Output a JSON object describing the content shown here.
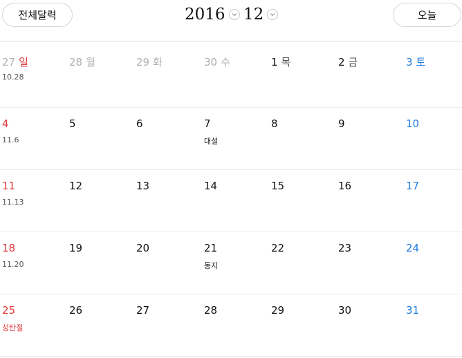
{
  "header": {
    "all_calendar_label": "전체달력",
    "year": "2016",
    "month": "12",
    "today_label": "오늘"
  },
  "colors": {
    "sunday": "#e03a3a",
    "saturday": "#1f7ae0",
    "other_month": "#b0b0b0"
  },
  "weeks": [
    [
      {
        "num": "27",
        "name": "일",
        "sub": "10.28",
        "num_style": "other",
        "name_style": "sun",
        "sub_style": "gray"
      },
      {
        "num": "28",
        "name": "월",
        "sub": "",
        "num_style": "other",
        "name_style": "other",
        "sub_style": ""
      },
      {
        "num": "29",
        "name": "화",
        "sub": "",
        "num_style": "other",
        "name_style": "other",
        "sub_style": ""
      },
      {
        "num": "30",
        "name": "수",
        "sub": "",
        "num_style": "other",
        "name_style": "other",
        "sub_style": ""
      },
      {
        "num": "1",
        "name": "목",
        "sub": "",
        "num_style": "norm",
        "name_style": "gray",
        "sub_style": ""
      },
      {
        "num": "2",
        "name": "금",
        "sub": "",
        "num_style": "norm",
        "name_style": "gray",
        "sub_style": ""
      },
      {
        "num": "3",
        "name": "토",
        "sub": "",
        "num_style": "sat",
        "name_style": "sat",
        "sub_style": ""
      }
    ],
    [
      {
        "num": "4",
        "name": "",
        "sub": "11.6",
        "num_style": "sun",
        "name_style": "",
        "sub_style": "gray"
      },
      {
        "num": "5",
        "name": "",
        "sub": "",
        "num_style": "norm",
        "name_style": "",
        "sub_style": ""
      },
      {
        "num": "6",
        "name": "",
        "sub": "",
        "num_style": "norm",
        "name_style": "",
        "sub_style": ""
      },
      {
        "num": "7",
        "name": "",
        "sub": "대설",
        "num_style": "norm",
        "name_style": "",
        "sub_style": "dark"
      },
      {
        "num": "8",
        "name": "",
        "sub": "",
        "num_style": "norm",
        "name_style": "",
        "sub_style": ""
      },
      {
        "num": "9",
        "name": "",
        "sub": "",
        "num_style": "norm",
        "name_style": "",
        "sub_style": ""
      },
      {
        "num": "10",
        "name": "",
        "sub": "",
        "num_style": "sat",
        "name_style": "",
        "sub_style": ""
      }
    ],
    [
      {
        "num": "11",
        "name": "",
        "sub": "11.13",
        "num_style": "sun",
        "name_style": "",
        "sub_style": "gray"
      },
      {
        "num": "12",
        "name": "",
        "sub": "",
        "num_style": "norm",
        "name_style": "",
        "sub_style": ""
      },
      {
        "num": "13",
        "name": "",
        "sub": "",
        "num_style": "norm",
        "name_style": "",
        "sub_style": ""
      },
      {
        "num": "14",
        "name": "",
        "sub": "",
        "num_style": "norm",
        "name_style": "",
        "sub_style": ""
      },
      {
        "num": "15",
        "name": "",
        "sub": "",
        "num_style": "norm",
        "name_style": "",
        "sub_style": ""
      },
      {
        "num": "16",
        "name": "",
        "sub": "",
        "num_style": "norm",
        "name_style": "",
        "sub_style": ""
      },
      {
        "num": "17",
        "name": "",
        "sub": "",
        "num_style": "sat",
        "name_style": "",
        "sub_style": ""
      }
    ],
    [
      {
        "num": "18",
        "name": "",
        "sub": "11.20",
        "num_style": "sun",
        "name_style": "",
        "sub_style": "gray"
      },
      {
        "num": "19",
        "name": "",
        "sub": "",
        "num_style": "norm",
        "name_style": "",
        "sub_style": ""
      },
      {
        "num": "20",
        "name": "",
        "sub": "",
        "num_style": "norm",
        "name_style": "",
        "sub_style": ""
      },
      {
        "num": "21",
        "name": "",
        "sub": "동지",
        "num_style": "norm",
        "name_style": "",
        "sub_style": "dark"
      },
      {
        "num": "22",
        "name": "",
        "sub": "",
        "num_style": "norm",
        "name_style": "",
        "sub_style": ""
      },
      {
        "num": "23",
        "name": "",
        "sub": "",
        "num_style": "norm",
        "name_style": "",
        "sub_style": ""
      },
      {
        "num": "24",
        "name": "",
        "sub": "",
        "num_style": "sat",
        "name_style": "",
        "sub_style": ""
      }
    ],
    [
      {
        "num": "25",
        "name": "",
        "sub": "성탄절",
        "num_style": "sun",
        "name_style": "",
        "sub_style": "sun"
      },
      {
        "num": "26",
        "name": "",
        "sub": "",
        "num_style": "norm",
        "name_style": "",
        "sub_style": ""
      },
      {
        "num": "27",
        "name": "",
        "sub": "",
        "num_style": "norm",
        "name_style": "",
        "sub_style": ""
      },
      {
        "num": "28",
        "name": "",
        "sub": "",
        "num_style": "norm",
        "name_style": "",
        "sub_style": ""
      },
      {
        "num": "29",
        "name": "",
        "sub": "",
        "num_style": "norm",
        "name_style": "",
        "sub_style": ""
      },
      {
        "num": "30",
        "name": "",
        "sub": "",
        "num_style": "norm",
        "name_style": "",
        "sub_style": ""
      },
      {
        "num": "31",
        "name": "",
        "sub": "",
        "num_style": "sat",
        "name_style": "",
        "sub_style": ""
      }
    ]
  ]
}
